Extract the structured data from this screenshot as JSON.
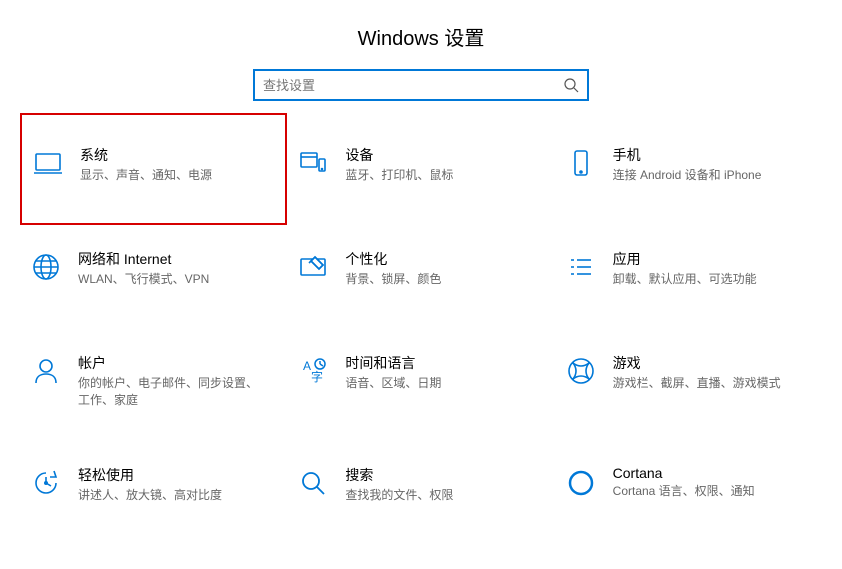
{
  "header": {
    "title": "Windows 设置"
  },
  "search": {
    "placeholder": "查找设置"
  },
  "accent": "#0078d7",
  "highlight_border": "#d60000",
  "tiles": [
    {
      "id": "system",
      "title": "系统",
      "desc": "显示、声音、通知、电源",
      "highlight": true
    },
    {
      "id": "devices",
      "title": "设备",
      "desc": "蓝牙、打印机、鼠标",
      "highlight": false
    },
    {
      "id": "phone",
      "title": "手机",
      "desc": "连接 Android 设备和 iPhone",
      "highlight": false
    },
    {
      "id": "network",
      "title": "网络和 Internet",
      "desc": "WLAN、飞行模式、VPN",
      "highlight": false
    },
    {
      "id": "personalize",
      "title": "个性化",
      "desc": "背景、锁屏、颜色",
      "highlight": false
    },
    {
      "id": "apps",
      "title": "应用",
      "desc": "卸载、默认应用、可选功能",
      "highlight": false
    },
    {
      "id": "accounts",
      "title": "帐户",
      "desc": "你的帐户、电子邮件、同步设置、工作、家庭",
      "highlight": false
    },
    {
      "id": "time",
      "title": "时间和语言",
      "desc": "语音、区域、日期",
      "highlight": false
    },
    {
      "id": "gaming",
      "title": "游戏",
      "desc": "游戏栏、截屏、直播、游戏模式",
      "highlight": false
    },
    {
      "id": "ease",
      "title": "轻松使用",
      "desc": "讲述人、放大镜、高对比度",
      "highlight": false
    },
    {
      "id": "search",
      "title": "搜索",
      "desc": "查找我的文件、权限",
      "highlight": false
    },
    {
      "id": "cortana",
      "title": "Cortana",
      "desc": "Cortana 语言、权限、通知",
      "highlight": false
    }
  ]
}
